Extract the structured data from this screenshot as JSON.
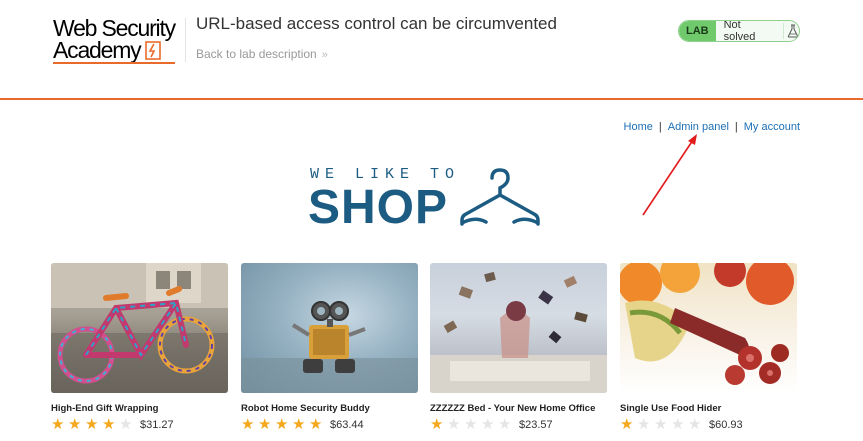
{
  "header": {
    "logo_line1": "Web Security",
    "logo_line2": "Academy",
    "lab_title": "URL-based access control can be circumvented",
    "back_link": "Back to lab description",
    "back_chevron": "»",
    "status_badge": "LAB",
    "status_text": "Not solved",
    "colors": {
      "accent": "#e96a2b",
      "lab_green": "#70c96b",
      "link": "#1d6fb6"
    }
  },
  "nav": {
    "items": [
      "Home",
      "Admin panel",
      "My account"
    ],
    "separator": "|"
  },
  "banner": {
    "tagline": "WE LIKE TO",
    "word": "SHOP",
    "icon": "hanger-icon"
  },
  "products": [
    {
      "name": "High-End Gift Wrapping",
      "rating": 4,
      "price": "$31.27",
      "image": "knitted-bicycle-photo"
    },
    {
      "name": "Robot Home Security Buddy",
      "rating": 5,
      "price": "$63.44",
      "image": "robot-toy-photo"
    },
    {
      "name": "ZZZZZZ Bed - Your New Home Office",
      "rating": 1,
      "price": "$23.57",
      "image": "flying-books-bed-photo"
    },
    {
      "name": "Single Use Food Hider",
      "rating": 1,
      "price": "$60.93",
      "image": "sausage-fruit-photo"
    }
  ]
}
